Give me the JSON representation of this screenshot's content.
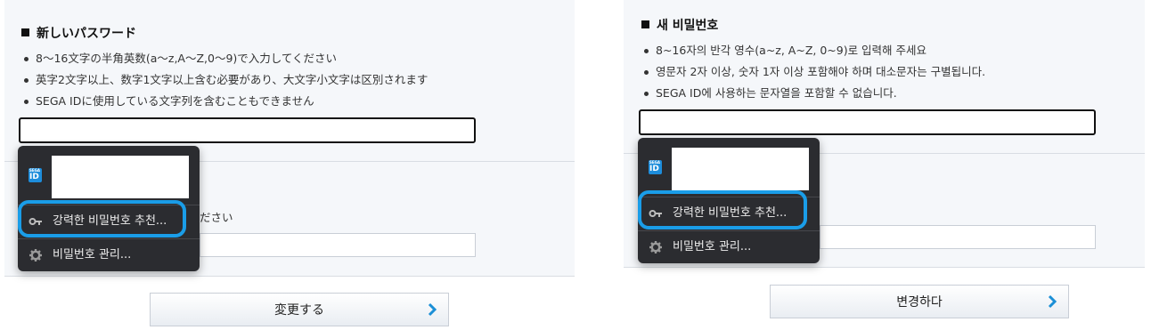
{
  "left": {
    "title": "新しいパスワード",
    "rules": [
      "8～16文字の半角英数(a～z,A～Z,0～9)で入力してください",
      "英字2文字以上、数字1文字以上含む必要があり、大文字小文字は区別されます",
      "SEGA IDに使用している文字列を含むこともできません"
    ],
    "password_value": "",
    "confirm_partial_text": "ださい",
    "confirm_value": "",
    "dropdown": {
      "account_icon": "sega-id-icon",
      "account_icon_text_top": "SEGA",
      "account_icon_text_bottom": "ID",
      "suggest_label": "강력한 비밀번호 추천...",
      "manage_label": "비밀번호 관리..."
    },
    "submit_label": "変更する"
  },
  "right": {
    "title": "새 비밀번호",
    "rules": [
      "8~16자의 반각 영수(a~z, A~Z, 0~9)로 입력해 주세요",
      "영문자 2자 이상, 숫자 1자 이상 포함해야 하며 대소문자는 구별됩니다.",
      "SEGA ID에 사용하는 문자열을 포함할 수 없습니다."
    ],
    "password_value": "",
    "confirm_value": "",
    "dropdown": {
      "account_icon": "sega-id-icon",
      "account_icon_text_top": "SEGA",
      "account_icon_text_bottom": "ID",
      "suggest_label": "강력한 비밀번호 추천...",
      "manage_label": "비밀번호 관리..."
    },
    "submit_label": "변경하다"
  },
  "colors": {
    "highlight": "#1a9de8",
    "dropdown_bg": "#2b2c30",
    "panel_bg": "#f5f7fa",
    "chevron": "#1b8fd6",
    "sega_blue": "#1d8ddb"
  },
  "icons": {
    "key": "key-icon",
    "gear": "gear-icon",
    "chevron": "chevron-right-icon"
  }
}
